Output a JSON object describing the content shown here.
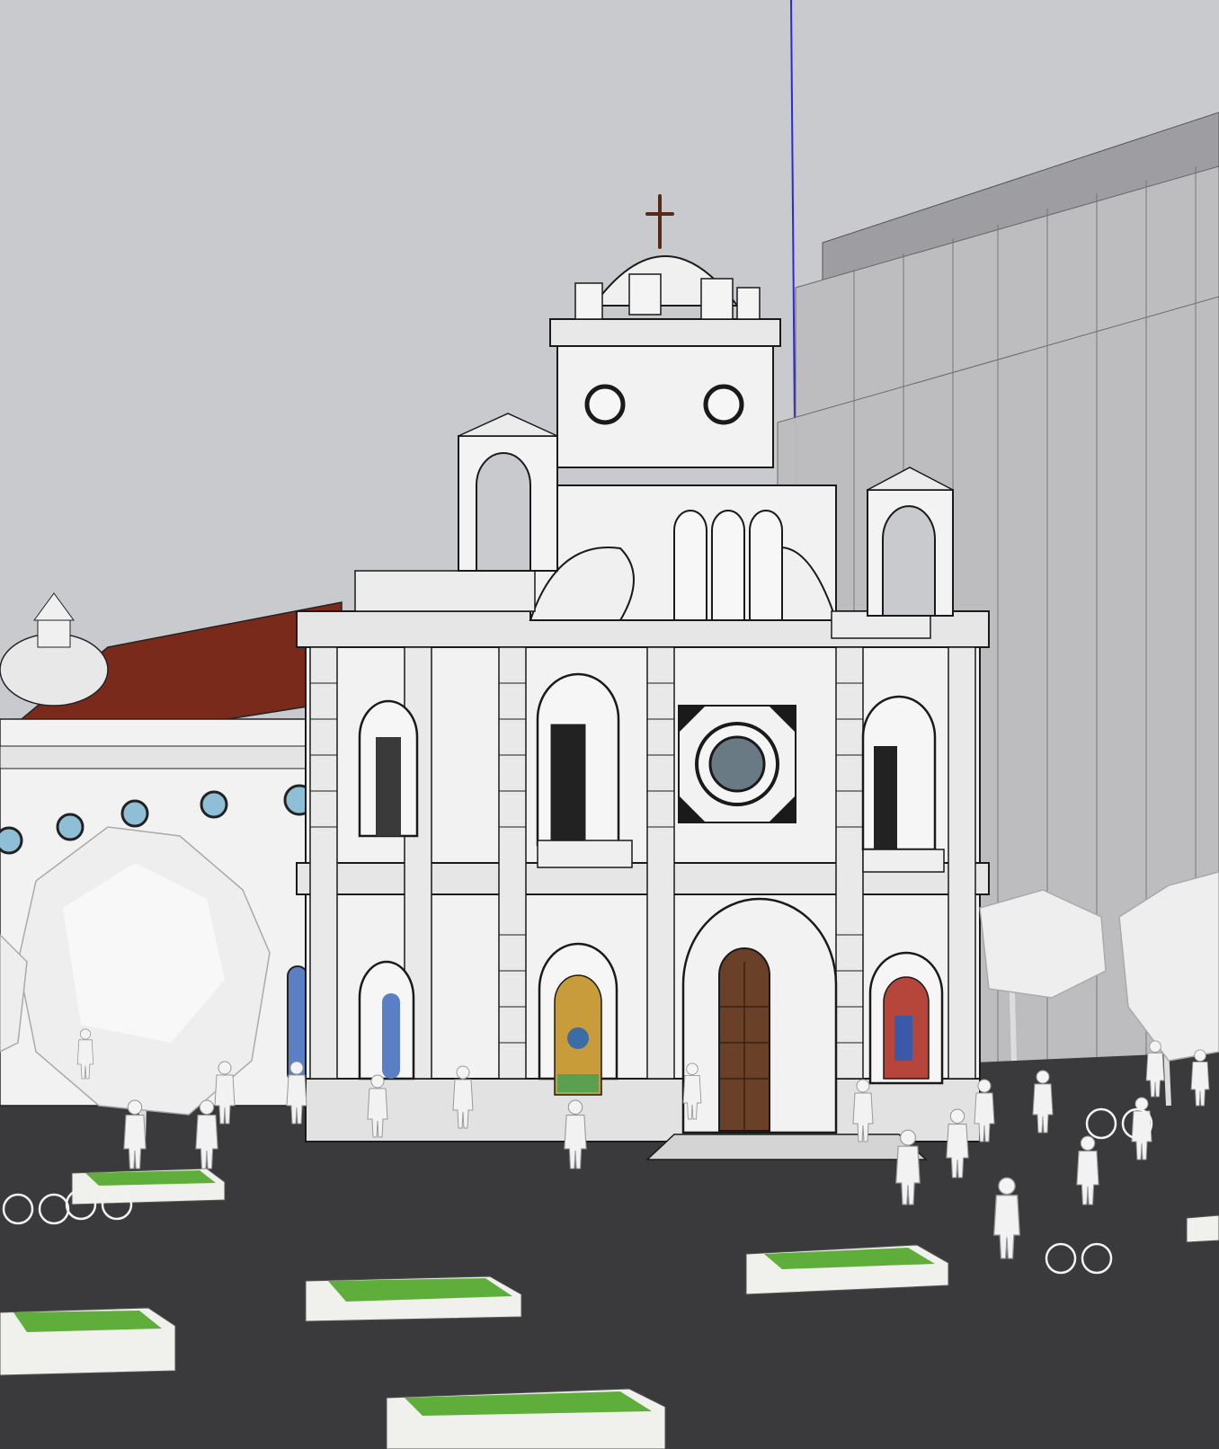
{
  "viewport": {
    "kind": "sketchup-3d-model-viewport",
    "visible_text": []
  },
  "colors": {
    "sky": "#c9cacd",
    "ground": "#3a3a3c",
    "facade": "#f2f2f2",
    "facade_shadow": "#d8d8d8",
    "outline": "#1a1a1a",
    "roof": "#7a2a1a",
    "door": "#6b4028",
    "tower_block": "#bdbdc0",
    "tower_block_top": "#9e9ea2",
    "planter_grass": "#5fae3c",
    "planter_rim": "#f0f0ec",
    "blue_axis": "#2a2adc",
    "window_glass": "#8fbfd6",
    "stained_glass_a": "#c89c3a",
    "stained_glass_b": "#b6463c",
    "tree_foliage": "#eeeeee"
  },
  "icons": {
    "cross": "cross-icon",
    "axis": "blue-axis-line"
  }
}
